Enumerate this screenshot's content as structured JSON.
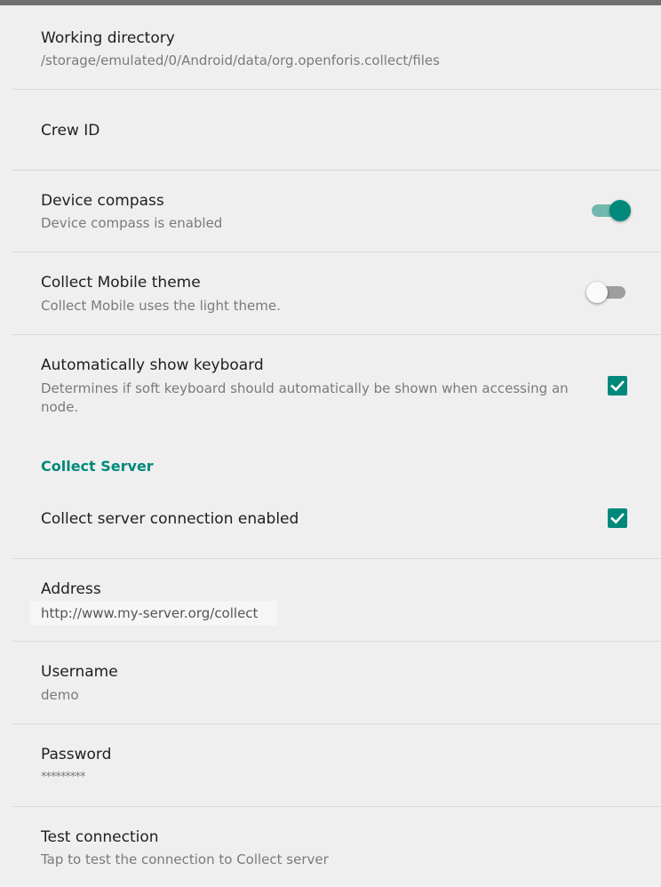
{
  "settings": {
    "working_directory": {
      "title": "Working directory",
      "summary": "/storage/emulated/0/Android/data/org.openforis.collect/files"
    },
    "crew_id": {
      "title": "Crew ID"
    },
    "device_compass": {
      "title": "Device compass",
      "summary": "Device compass is enabled",
      "enabled": true
    },
    "theme": {
      "title": "Collect Mobile theme",
      "summary": "Collect Mobile uses the light theme.",
      "enabled": false
    },
    "keyboard": {
      "title": "Automatically show keyboard",
      "summary": "Determines if soft keyboard should automatically be shown when accessing an node.",
      "checked": true
    },
    "server_category": {
      "label": "Collect Server"
    },
    "server_connection": {
      "title": "Collect server connection enabled",
      "checked": true
    },
    "address": {
      "title": "Address",
      "value": "http://www.my-server.org/collect"
    },
    "username": {
      "title": "Username",
      "value": "demo"
    },
    "password": {
      "title": "Password",
      "value": "*********"
    },
    "test_connection": {
      "title": "Test connection",
      "summary": "Tap to test the connection to Collect server"
    }
  },
  "colors": {
    "accent": "#00897b",
    "background": "#efefef"
  },
  "icons": {
    "checkbox": "check-icon"
  }
}
